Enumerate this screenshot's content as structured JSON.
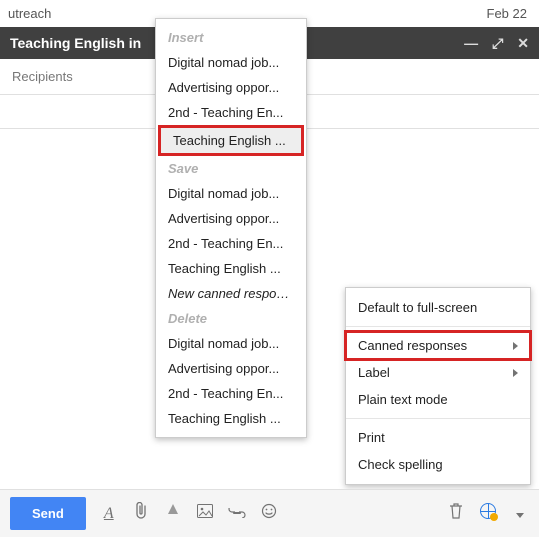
{
  "top": {
    "left": "utreach",
    "date": "Feb 22"
  },
  "compose": {
    "title": "Teaching English in",
    "recipients_placeholder": "Recipients"
  },
  "canned": {
    "insert_label": "Insert",
    "save_label": "Save",
    "delete_label": "Delete",
    "items": {
      "digital": "Digital nomad job...",
      "advertising": "Advertising oppor...",
      "second": "2nd - Teaching En...",
      "teaching": "Teaching English ...",
      "new": "New canned response..."
    }
  },
  "context": {
    "default_fs": "Default to full-screen",
    "canned": "Canned responses",
    "label": "Label",
    "plain": "Plain text mode",
    "print": "Print",
    "spell": "Check spelling"
  },
  "toolbar": {
    "send": "Send"
  }
}
